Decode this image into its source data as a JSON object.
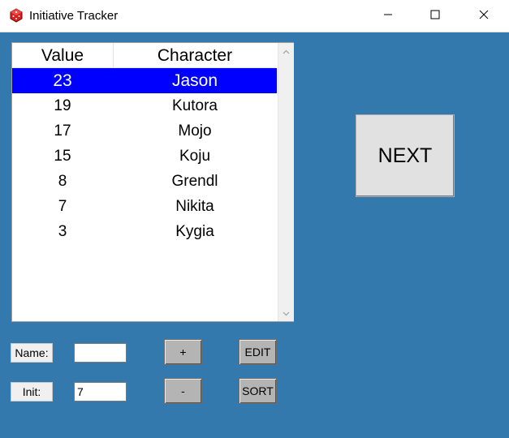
{
  "window": {
    "title": "Initiative Tracker",
    "app_icon": "red-die-icon",
    "controls": [
      "minimize-icon",
      "maximize-icon",
      "close-icon"
    ]
  },
  "list": {
    "headers": {
      "value": "Value",
      "character": "Character"
    },
    "rows": [
      {
        "value": "23",
        "character": "Jason",
        "selected": true
      },
      {
        "value": "19",
        "character": "Kutora"
      },
      {
        "value": "17",
        "character": "Mojo"
      },
      {
        "value": "15",
        "character": "Koju"
      },
      {
        "value": "8",
        "character": "Grendl"
      },
      {
        "value": "7",
        "character": "Nikita"
      },
      {
        "value": "3",
        "character": "Kygia"
      }
    ],
    "selection_color": "#0000ff"
  },
  "buttons": {
    "next": "NEXT",
    "plus": "+",
    "minus": "-",
    "edit": "EDIT",
    "sort": "SORT"
  },
  "form": {
    "name_label": "Name:",
    "name_value": "",
    "init_label": "Init:",
    "init_value": "7"
  },
  "colors": {
    "background": "#3479ad",
    "next_button": "#e1e1e1",
    "small_button": "#b4b4b4"
  }
}
